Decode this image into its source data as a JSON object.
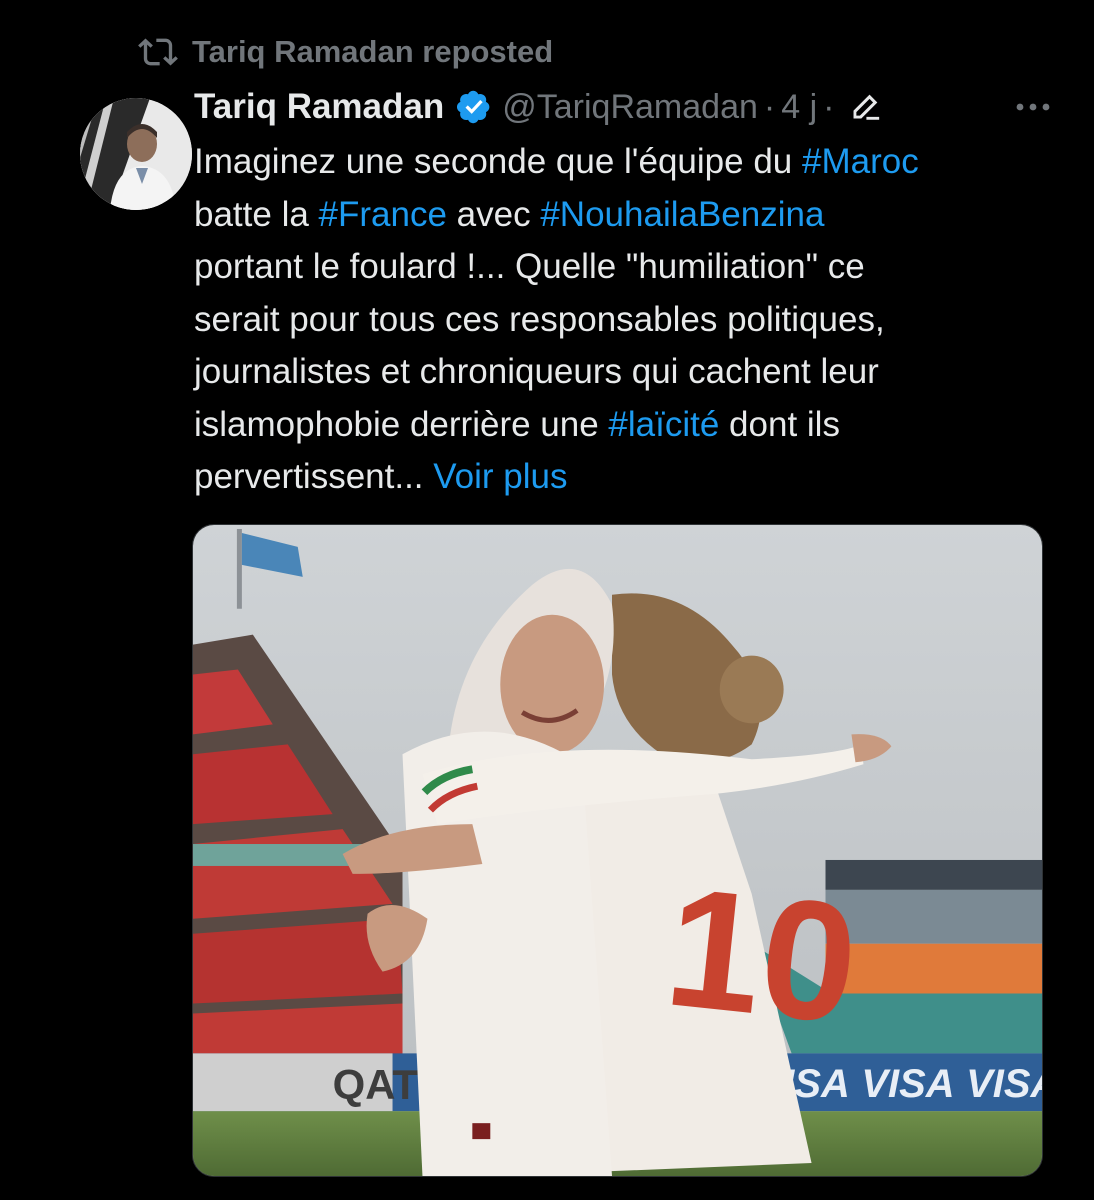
{
  "repost": {
    "icon": "repost-icon",
    "text": "Tariq Ramadan reposted"
  },
  "tweet": {
    "author_name": "Tariq Ramadan",
    "verified_icon": "verified-badge-icon",
    "handle": "@TariqRamadan",
    "separator": "·",
    "time": "4 j",
    "edit_icon": "edit-pencil-icon",
    "more_icon": "more-options-icon",
    "lines": [
      {
        "before": "Imaginez une seconde que l'équipe du ",
        "tag": "#Maroc",
        "after": ""
      },
      {
        "before": "batte la ",
        "tag": "#France",
        "mid": " avec ",
        "tag2": "#NouhailaBenzina"
      },
      {
        "text": "portant le foulard !... Quelle \"humiliation\" ce"
      },
      {
        "text": "serait pour tous ces responsables politiques,"
      },
      {
        "text": "journalistes et chroniqueurs qui cachent leur"
      },
      {
        "before": "islamophobie derrière une ",
        "tag": "#laïcité",
        "after": " dont ils"
      },
      {
        "before": "pervertissent... ",
        "link": "Voir plus"
      }
    ],
    "media": {
      "jersey_number": "10",
      "banner_text_1": "QAT",
      "banner_text_2": "VISA",
      "banner_text_3": "VISA",
      "banner_text_4": "VISA"
    }
  },
  "colors": {
    "background": "#000000",
    "text_primary": "#e7e9ea",
    "text_secondary": "#71767b",
    "link_blue": "#1d9bf0",
    "verified_blue": "#1d9bf0"
  }
}
